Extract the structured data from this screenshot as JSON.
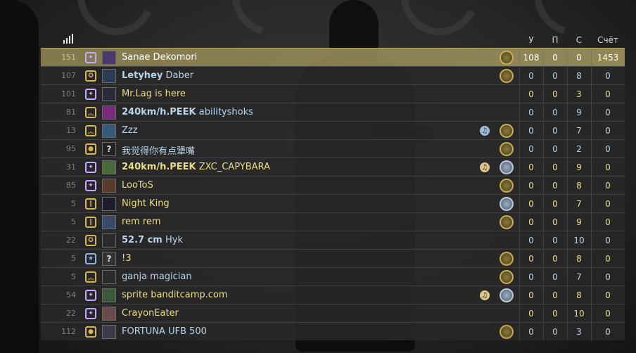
{
  "header": {
    "kills_label": "У",
    "assists_label": "П",
    "deaths_label": "С",
    "score_label": "Счёт"
  },
  "players": [
    {
      "level": "151",
      "name_bold": "",
      "name": "Sanae Dekomori",
      "avatar": "",
      "rank_icon": "rank-badge-purple",
      "rank_color": "#c9a7ff",
      "music": "",
      "medal": "medal-gold",
      "kills": "108",
      "assists": "0",
      "deaths": "0",
      "score": "1453",
      "team": "t",
      "highlight": true
    },
    {
      "level": "107",
      "name_bold": "Letyhey",
      "name": "Daber",
      "avatar": "",
      "rank_icon": "rank-wings-gold",
      "rank_color": "#d8b455",
      "music": "",
      "medal": "medal-gold",
      "kills": "0",
      "assists": "0",
      "deaths": "8",
      "score": "0",
      "team": "ct",
      "highlight": false
    },
    {
      "level": "101",
      "name_bold": "",
      "name": "Mr.Lag is here",
      "avatar": "",
      "rank_icon": "rank-badge-purple",
      "rank_color": "#c9a7ff",
      "music": "",
      "medal": "",
      "kills": "0",
      "assists": "0",
      "deaths": "3",
      "score": "0",
      "team": "t",
      "highlight": false
    },
    {
      "level": "81",
      "name_bold": "240km/h.PEEK",
      "name": "abilityshoks",
      "avatar": "",
      "rank_icon": "rank-chevron-gold",
      "rank_color": "#d8b455",
      "music": "",
      "medal": "",
      "kills": "0",
      "assists": "0",
      "deaths": "9",
      "score": "0",
      "team": "ct",
      "highlight": false
    },
    {
      "level": "13",
      "name_bold": "",
      "name": "Zzz",
      "avatar": "",
      "rank_icon": "rank-chevron-gold",
      "rank_color": "#d8b455",
      "music": "blue",
      "medal": "medal-gold",
      "kills": "0",
      "assists": "0",
      "deaths": "7",
      "score": "0",
      "team": "ct",
      "highlight": false
    },
    {
      "level": "95",
      "name_bold": "",
      "name": "我觉得你有点犟嘴",
      "avatar": "?",
      "rank_icon": "rank-dot-gold",
      "rank_color": "#d8b455",
      "music": "",
      "medal": "medal-gold",
      "kills": "0",
      "assists": "0",
      "deaths": "2",
      "score": "0",
      "team": "ct",
      "highlight": false
    },
    {
      "level": "31",
      "name_bold": "240km/h.PEEK",
      "name": "ZXC_CAPYBARA",
      "avatar": "",
      "rank_icon": "rank-badge-purple",
      "rank_color": "#c9a7ff",
      "music": "gold",
      "medal": "medal-silver",
      "kills": "0",
      "assists": "0",
      "deaths": "9",
      "score": "0",
      "team": "t",
      "highlight": false
    },
    {
      "level": "85",
      "name_bold": "",
      "name": "LooToS",
      "avatar": "",
      "rank_icon": "rank-badge-purple",
      "rank_color": "#c9a7ff",
      "music": "",
      "medal": "medal-gold",
      "kills": "0",
      "assists": "0",
      "deaths": "8",
      "score": "0",
      "team": "t",
      "highlight": false
    },
    {
      "level": "5",
      "name_bold": "",
      "name": "Night King",
      "avatar": "",
      "rank_icon": "rank-bars-gold",
      "rank_color": "#d8b455",
      "music": "",
      "medal": "medal-silver",
      "kills": "0",
      "assists": "0",
      "deaths": "7",
      "score": "0",
      "team": "t",
      "highlight": false
    },
    {
      "level": "5",
      "name_bold": "",
      "name": "rem rem",
      "avatar": "",
      "rank_icon": "rank-bars-gold",
      "rank_color": "#d8b455",
      "music": "",
      "medal": "medal-gold",
      "kills": "0",
      "assists": "0",
      "deaths": "9",
      "score": "0",
      "team": "t",
      "highlight": false
    },
    {
      "level": "22",
      "name_bold": "52.7 cm",
      "name": "Hyk",
      "avatar": "",
      "rank_icon": "rank-wings-gold",
      "rank_color": "#d8b455",
      "music": "",
      "medal": "",
      "kills": "0",
      "assists": "0",
      "deaths": "10",
      "score": "0",
      "team": "ct",
      "highlight": false
    },
    {
      "level": "5",
      "name_bold": "",
      "name": "!3",
      "avatar": "?",
      "rank_icon": "rank-star-blue",
      "rank_color": "#8fb3e8",
      "music": "",
      "medal": "medal-gold",
      "kills": "0",
      "assists": "0",
      "deaths": "8",
      "score": "0",
      "team": "t",
      "highlight": false
    },
    {
      "level": "5",
      "name_bold": "",
      "name": "ganja magician",
      "avatar": "",
      "rank_icon": "rank-chevron-gold",
      "rank_color": "#d8b455",
      "music": "",
      "medal": "medal-gold",
      "kills": "0",
      "assists": "0",
      "deaths": "7",
      "score": "0",
      "team": "ct",
      "highlight": false
    },
    {
      "level": "54",
      "name_bold": "",
      "name": "sprite banditcamp.com",
      "avatar": "",
      "rank_icon": "rank-badge-purple",
      "rank_color": "#c9a7ff",
      "music": "gold",
      "medal": "medal-silver",
      "kills": "0",
      "assists": "0",
      "deaths": "8",
      "score": "0",
      "team": "t",
      "highlight": false
    },
    {
      "level": "22",
      "name_bold": "",
      "name": "CrayonEater",
      "avatar": "",
      "rank_icon": "rank-badge-purple",
      "rank_color": "#c9a7ff",
      "music": "",
      "medal": "",
      "kills": "0",
      "assists": "0",
      "deaths": "10",
      "score": "0",
      "team": "t",
      "highlight": false
    },
    {
      "level": "112",
      "name_bold": "",
      "name": "FORTUNA UFB 500",
      "avatar": "",
      "rank_icon": "rank-dot-gold",
      "rank_color": "#d8b455",
      "music": "",
      "medal": "medal-gold",
      "kills": "0",
      "assists": "0",
      "deaths": "3",
      "score": "0",
      "team": "ct",
      "highlight": false
    }
  ]
}
